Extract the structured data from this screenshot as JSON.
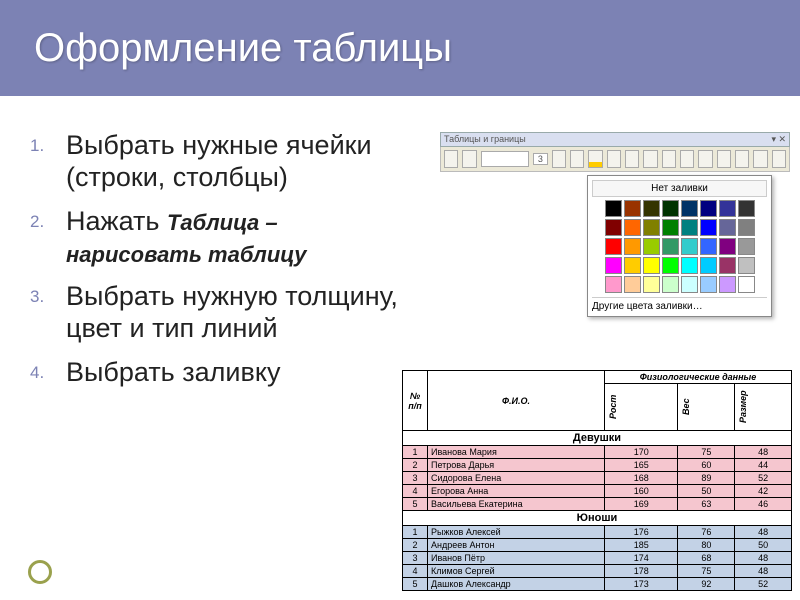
{
  "title": "Оформление таблицы",
  "steps": {
    "s1": "Выбрать нужные ячейки (строки, столбцы)",
    "s2_prefix": "Нажать ",
    "s2_em": "Таблица – нарисовать таблицу",
    "s3": "Выбрать нужную толщину, цвет и тип линий",
    "s4": "Выбрать заливку"
  },
  "toolbar": {
    "title": "Таблицы и границы",
    "border_width": "3"
  },
  "palette": {
    "no_fill": "Нет заливки",
    "more_colors": "Другие цвета заливки…",
    "colors": [
      "#000000",
      "#993300",
      "#333300",
      "#003300",
      "#003366",
      "#000080",
      "#333399",
      "#333333",
      "#800000",
      "#ff6600",
      "#808000",
      "#008000",
      "#008080",
      "#0000ff",
      "#666699",
      "#808080",
      "#ff0000",
      "#ff9900",
      "#99cc00",
      "#339966",
      "#33cccc",
      "#3366ff",
      "#800080",
      "#999999",
      "#ff00ff",
      "#ffcc00",
      "#ffff00",
      "#00ff00",
      "#00ffff",
      "#00ccff",
      "#993366",
      "#c0c0c0",
      "#ff99cc",
      "#ffcc99",
      "#ffff99",
      "#ccffcc",
      "#ccffff",
      "#99ccff",
      "#cc99ff",
      "#ffffff"
    ]
  },
  "table": {
    "headers": {
      "num": "№ п/п",
      "fio": "Ф.И.О.",
      "phys": "Физиологические данные",
      "height": "Рост",
      "weight": "Вес",
      "size": "Размер"
    },
    "section_girls": "Девушки",
    "section_boys": "Юноши",
    "girls": [
      {
        "n": "1",
        "name": "Иванова Мария",
        "h": "170",
        "w": "75",
        "s": "48"
      },
      {
        "n": "2",
        "name": "Петрова Дарья",
        "h": "165",
        "w": "60",
        "s": "44"
      },
      {
        "n": "3",
        "name": "Сидорова Елена",
        "h": "168",
        "w": "89",
        "s": "52"
      },
      {
        "n": "4",
        "name": "Егорова Анна",
        "h": "160",
        "w": "50",
        "s": "42"
      },
      {
        "n": "5",
        "name": "Васильева Екатерина",
        "h": "169",
        "w": "63",
        "s": "46"
      }
    ],
    "boys": [
      {
        "n": "1",
        "name": "Рыжков Алексей",
        "h": "176",
        "w": "76",
        "s": "48"
      },
      {
        "n": "2",
        "name": "Андреев Антон",
        "h": "185",
        "w": "80",
        "s": "50"
      },
      {
        "n": "3",
        "name": "Иванов Пётр",
        "h": "174",
        "w": "68",
        "s": "48"
      },
      {
        "n": "4",
        "name": "Климов Сергей",
        "h": "178",
        "w": "75",
        "s": "48"
      },
      {
        "n": "5",
        "name": "Дашков Александр",
        "h": "173",
        "w": "92",
        "s": "52"
      }
    ]
  }
}
